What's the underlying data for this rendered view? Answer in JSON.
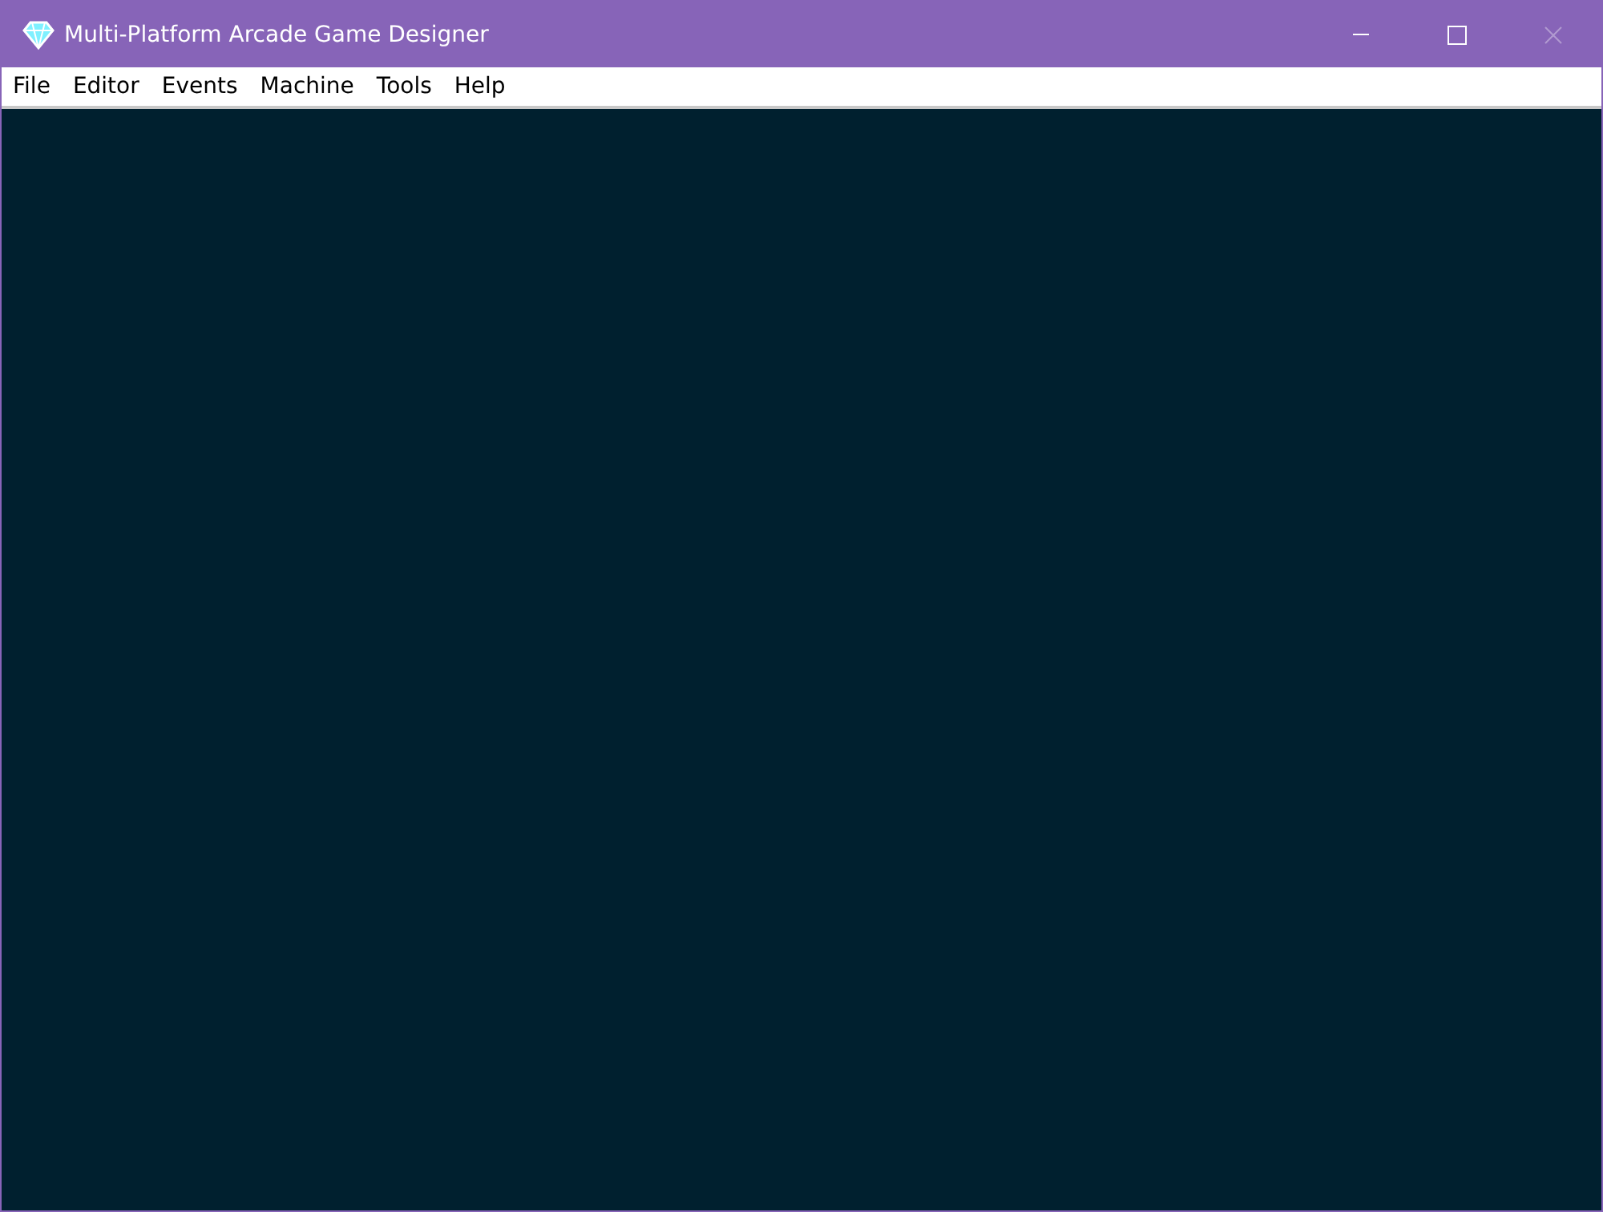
{
  "window": {
    "title": "Multi-Platform Arcade Game Designer",
    "close_disabled": true
  },
  "menu": [
    "File",
    "Editor",
    "Events",
    "Machine",
    "Tools",
    "Help"
  ]
}
